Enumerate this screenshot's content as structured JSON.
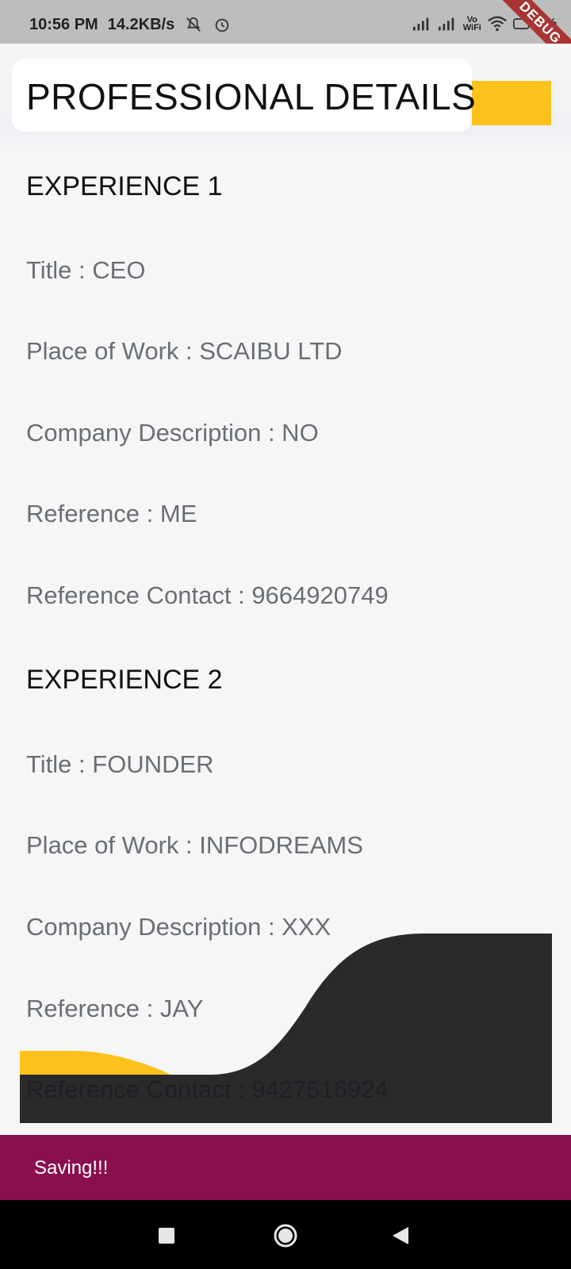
{
  "status_bar": {
    "time": "10:56 PM",
    "speed": "14.2KB/s",
    "icons": [
      "mute-icon",
      "alarm-icon",
      "signal-icon",
      "signal-icon",
      "vowifi-icon",
      "wifi-icon",
      "battery-icon"
    ],
    "vowifi_top": "Vo",
    "vowifi_bottom": "WiFi",
    "battery": "3%"
  },
  "debug_banner": "DEBUG",
  "header": {
    "title": "PROFESSIONAL DETAILS"
  },
  "experiences": [
    {
      "heading": "EXPERIENCE 1",
      "title": "Title : CEO",
      "place": "Place of Work : SCAIBU LTD",
      "description": "Company Description : NO",
      "reference": "Reference : ME",
      "contact": "Reference Contact : 9664920749"
    },
    {
      "heading": "EXPERIENCE 2",
      "title": "Title : FOUNDER",
      "place": "Place of Work : INFODREAMS",
      "description": "Company Description : XXX",
      "reference": "Reference : JAY",
      "contact": "Reference Contact : 9427516924"
    }
  ],
  "snackbar": {
    "message": "Saving!!!"
  },
  "colors": {
    "accent_yellow": "#fcc21b",
    "wave_dark": "#2a2a2a",
    "snackbar_bg": "#8a0f4f",
    "text_muted": "#6a6f76"
  },
  "nav_bar": {
    "icons": [
      "recents-icon",
      "home-icon",
      "back-icon"
    ]
  }
}
